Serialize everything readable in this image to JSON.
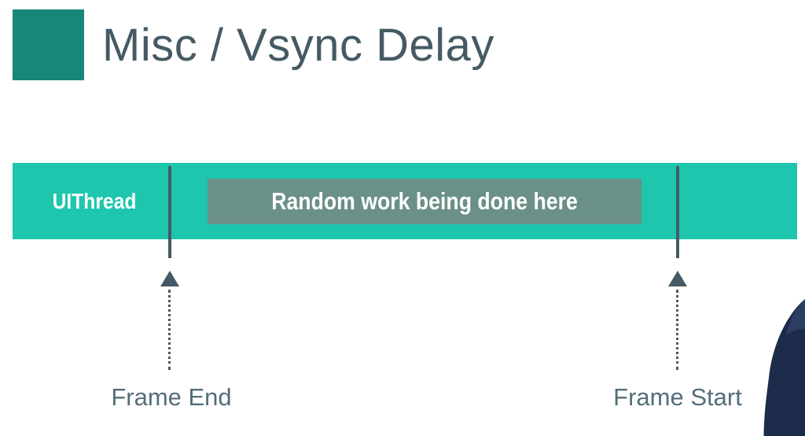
{
  "slide": {
    "title": "Misc / Vsync Delay",
    "accent_color": "#16877a"
  },
  "diagram": {
    "thread_label": "UIThread",
    "thread_bar_color": "#1dc6ad",
    "work_block_label": "Random work being done here",
    "work_block_color": "#6a9088",
    "markers": [
      {
        "label": "Frame End",
        "arrow": "up-arrow"
      },
      {
        "label": "Frame Start",
        "arrow": "up-arrow"
      }
    ]
  }
}
